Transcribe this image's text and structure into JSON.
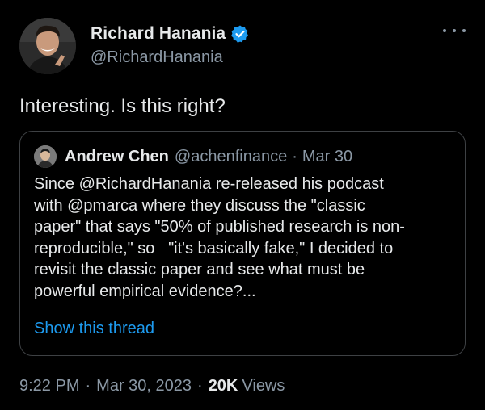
{
  "author": {
    "display_name": "Richard Hanania",
    "handle": "@RichardHanania",
    "verified": true,
    "avatar_icon": "profile-photo"
  },
  "more_icon": "more-options-icon",
  "tweet": {
    "text": "Interesting. Is this right?"
  },
  "quote": {
    "display_name": "Andrew Chen",
    "handle": "@achenfinance",
    "separator": "·",
    "date": "Mar 30",
    "lines": [
      "Since @RichardHanania re-released his podcast",
      "with @pmarca where they discuss the \"classic",
      "paper\" that says \"50% of published research is non-",
      "reproducible,\" so   \"it's basically fake,\" I decided to",
      "revisit the classic paper and see what must be",
      "powerful empirical evidence?..."
    ],
    "show_thread": "Show this thread"
  },
  "meta": {
    "time": "9:22 PM",
    "separator": "·",
    "date": "Mar 30, 2023",
    "views_count": "20K",
    "views_label": "Views"
  },
  "colors": {
    "background": "#000000",
    "text": "#e7e9ea",
    "secondary": "#8b98a5",
    "link": "#1d9bf0",
    "verified": "#1d9bf0",
    "border": "#3e4144"
  }
}
